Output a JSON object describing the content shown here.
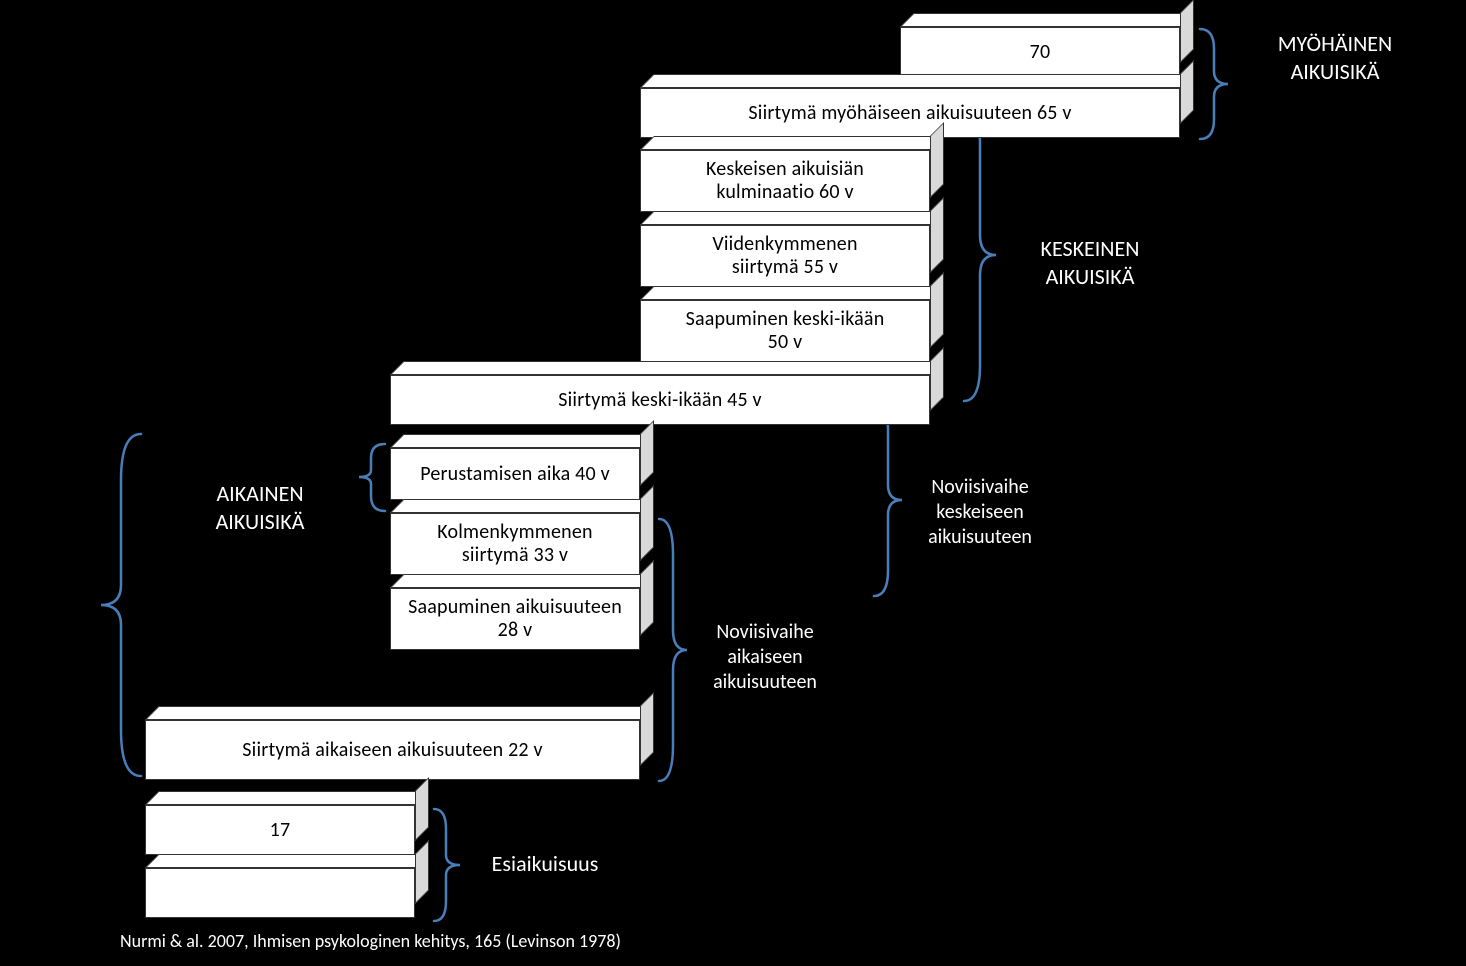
{
  "title_top_right": "MYÖHÄINEN\nAIKUISIKÄ",
  "era_middle": "KESKEINEN\nAIKUISIKÄ",
  "era_early": "AIKAINEN\nAIKUISIKÄ",
  "novice_middle": "Noviisivaihe\nkeskeiseen\naikuisuuteen",
  "novice_early": "Noviisivaihe\naikaiseen\naikuisuuteen",
  "preadult": "Esiaikuisuus",
  "source": "Nurmi & al. 2007, Ihmisen psykologinen kehitys, 165 (Levinson 1978)",
  "boxes": {
    "b70": "70",
    "trans_late": "Siirtymä myöhäiseen aikuisuuteen  65 v",
    "culm60": "Keskeisen  aikuisiän\nkulminaatio 60 v",
    "fifty55": "Viidenkymmenen\nsiirtymä  55 v",
    "mid50": "Saapuminen keski-ikään\n50 v",
    "trans_mid45": "Siirtymä keski-ikään  45 v",
    "settle40": "Perustamisen aika  40 v",
    "thirty33": "Kolmenkymmenen\nsiirtymä  33 v",
    "enter28": "Saapuminen aikuisuuteen\n28 v",
    "trans_early22": "Siirtymä aikaiseen aikuisuuteen  22 v",
    "b17": "17",
    "blank": ""
  }
}
